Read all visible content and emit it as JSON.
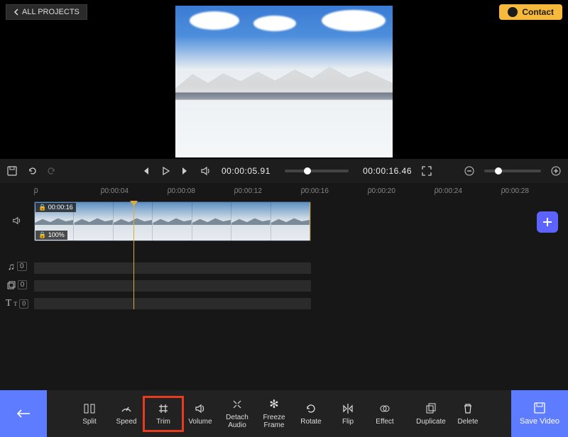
{
  "header": {
    "all_projects": "ALL PROJECTS",
    "contact": "Contact"
  },
  "transport": {
    "current_time": "00:00:05.91",
    "total_time": "00:00:16.46",
    "seek_percent": 36,
    "zoom_percent": 25
  },
  "ruler": [
    "0",
    "00:00:04",
    "00:00:08",
    "00:00:12",
    "00:00:16",
    "00:00:20",
    "00:00:24",
    "00:00:28"
  ],
  "clip": {
    "duration_label": "00:00:16",
    "speed_label": "100%"
  },
  "side_tracks": {
    "music_count": "0",
    "overlay_count": "0",
    "text_count": "0"
  },
  "tools": {
    "split": "Split",
    "speed": "Speed",
    "trim": "Trim",
    "volume": "Volume",
    "detach": "Detach Audio",
    "freeze": "Freeze Frame",
    "rotate": "Rotate",
    "flip": "Flip",
    "effect": "Effect",
    "duplicate": "Duplicate",
    "delete": "Delete"
  },
  "save": "Save Video"
}
